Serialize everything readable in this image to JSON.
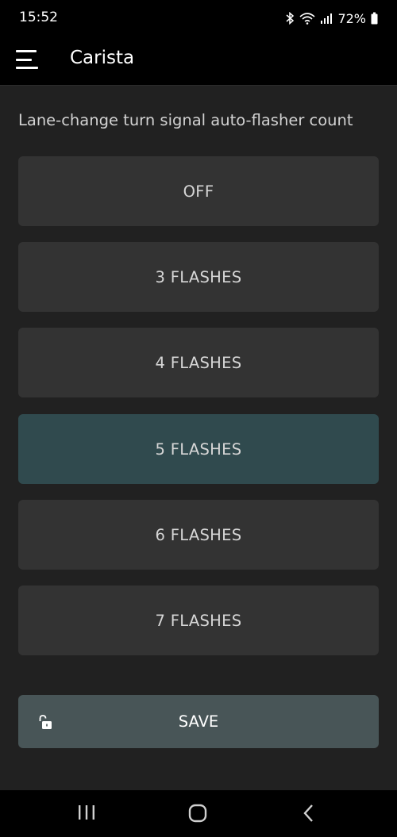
{
  "status_bar": {
    "time": "15:52",
    "battery_percent": "72%",
    "icons": [
      "bluetooth-icon",
      "wifi-icon",
      "signal-icon",
      "battery-icon"
    ]
  },
  "app_bar": {
    "title": "Carista",
    "menu_icon": "hamburger-menu-icon"
  },
  "setting": {
    "label": "Lane-change turn signal auto-flasher count",
    "selected_index": 3,
    "options": [
      {
        "label": "OFF"
      },
      {
        "label": "3 FLASHES"
      },
      {
        "label": "4 FLASHES"
      },
      {
        "label": "5 FLASHES"
      },
      {
        "label": "6 FLASHES"
      },
      {
        "label": "7 FLASHES"
      }
    ]
  },
  "save_button": {
    "label": "SAVE",
    "icon": "unlocked-padlock-icon"
  },
  "nav_bar": {
    "buttons": [
      "recent-apps-icon",
      "home-icon",
      "back-icon"
    ]
  },
  "colors": {
    "background": "#212121",
    "option_bg": "#333333",
    "option_selected_bg": "#304a4e",
    "save_bg": "#485557",
    "text": "#d6d6d6"
  }
}
